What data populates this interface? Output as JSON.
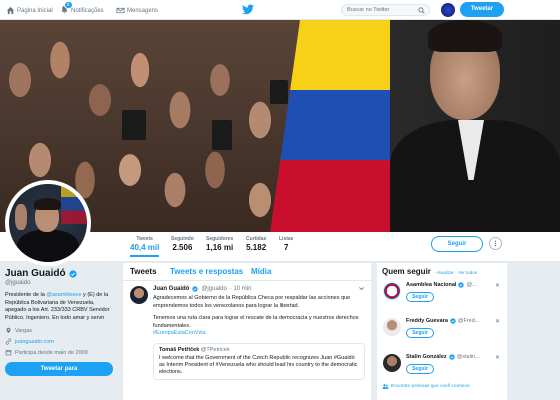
{
  "nav": {
    "home": "Página Inicial",
    "notifications": "Notificações",
    "notifications_count": "5",
    "messages": "Mensagens",
    "search_placeholder": "Buscar no Twitter",
    "tweet_button": "Tweetar"
  },
  "profile": {
    "name": "Juan Guaidó",
    "handle": "@jguaido",
    "bio_pre": "Presidente de la ",
    "bio_link": "@asambleave",
    "bio_post": " y (E) de la República Bolivariana de Venezuela, apegado a los Art. 233/333 CRBV Servidor Público. Ingeniero. En todo amar y servir",
    "location": "Vargas",
    "website": "juanguaido.com",
    "joined": "Participa desde maio de 2009",
    "tweet_to": "Tweetar para"
  },
  "stats": [
    {
      "label": "Tweets",
      "value": "40,4 mil"
    },
    {
      "label": "Seguindo",
      "value": "2.506"
    },
    {
      "label": "Seguidores",
      "value": "1,16 mi"
    },
    {
      "label": "Curtidas",
      "value": "5.182"
    },
    {
      "label": "Listas",
      "value": "7"
    }
  ],
  "actions": {
    "follow": "Seguir"
  },
  "tabs": [
    "Tweets",
    "Tweets e respostas",
    "Mídia"
  ],
  "tweet": {
    "author": "Juan Guaidó",
    "handle": "@jguaido",
    "time": "· 10 min",
    "text1": "Agradecemos al Gobierno de la República Checa por respaldar las acciones que emprendemos todos los venezolanos para lograr la libertad.",
    "text2": "Tenemos una ruta clara para lograr el rescate de la democracia y nuestros derechos fundamentales.",
    "hashtag": "#EuropaEstaConVzla",
    "quote_author": "Tomáš Petříček",
    "quote_handle": "@TPetricek",
    "quote_text": "I welcome that the Government of the Czech Republic recognizes Juan #Guaidó as Interim President of #Venezuela who should lead his country to the democratic elections."
  },
  "who_to_follow": {
    "title": "Quem seguir",
    "sep": "·",
    "refresh": "Atualizar",
    "view_all": "Ver todos",
    "items": [
      {
        "name": "Asamblea Nacional",
        "handle": "@...",
        "button": "Seguir"
      },
      {
        "name": "Freddy Guevara",
        "handle": "@Fred...",
        "button": "Seguir"
      },
      {
        "name": "Stalin González",
        "handle": "@stalin...",
        "button": "Seguir"
      }
    ],
    "find_people": "Encontre pessoas que você conhece"
  }
}
